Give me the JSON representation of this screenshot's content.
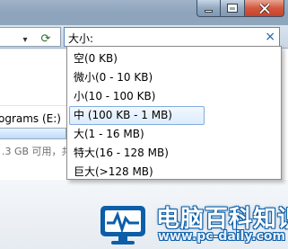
{
  "search": {
    "query": "大小:",
    "clear_glyph": "×"
  },
  "nav": {
    "dropdown_glyph": "▾",
    "refresh_glyph": "⟳"
  },
  "drive": {
    "label": "ograms (E:)",
    "info": ".3 GB 可用，共"
  },
  "size_filter_menu": {
    "items": [
      {
        "label": "空(0 KB)",
        "selected": false
      },
      {
        "label": "微小(0 - 10 KB)",
        "selected": false
      },
      {
        "label": "小(10 - 100 KB)",
        "selected": false
      },
      {
        "label": "中 (100 KB - 1 MB)",
        "selected": true
      },
      {
        "label": "大(1 - 16 MB)",
        "selected": false
      },
      {
        "label": "特大(16 - 128 MB)",
        "selected": false
      },
      {
        "label": "巨大(>128 MB)",
        "selected": false
      }
    ]
  },
  "watermark": {
    "title": "电脑百科知识",
    "url": "www.pc-daily.com",
    "brand_color": "#0d5ea8"
  },
  "colors": {
    "selection_border": "#84acdd",
    "close_button": "#c7432a"
  }
}
